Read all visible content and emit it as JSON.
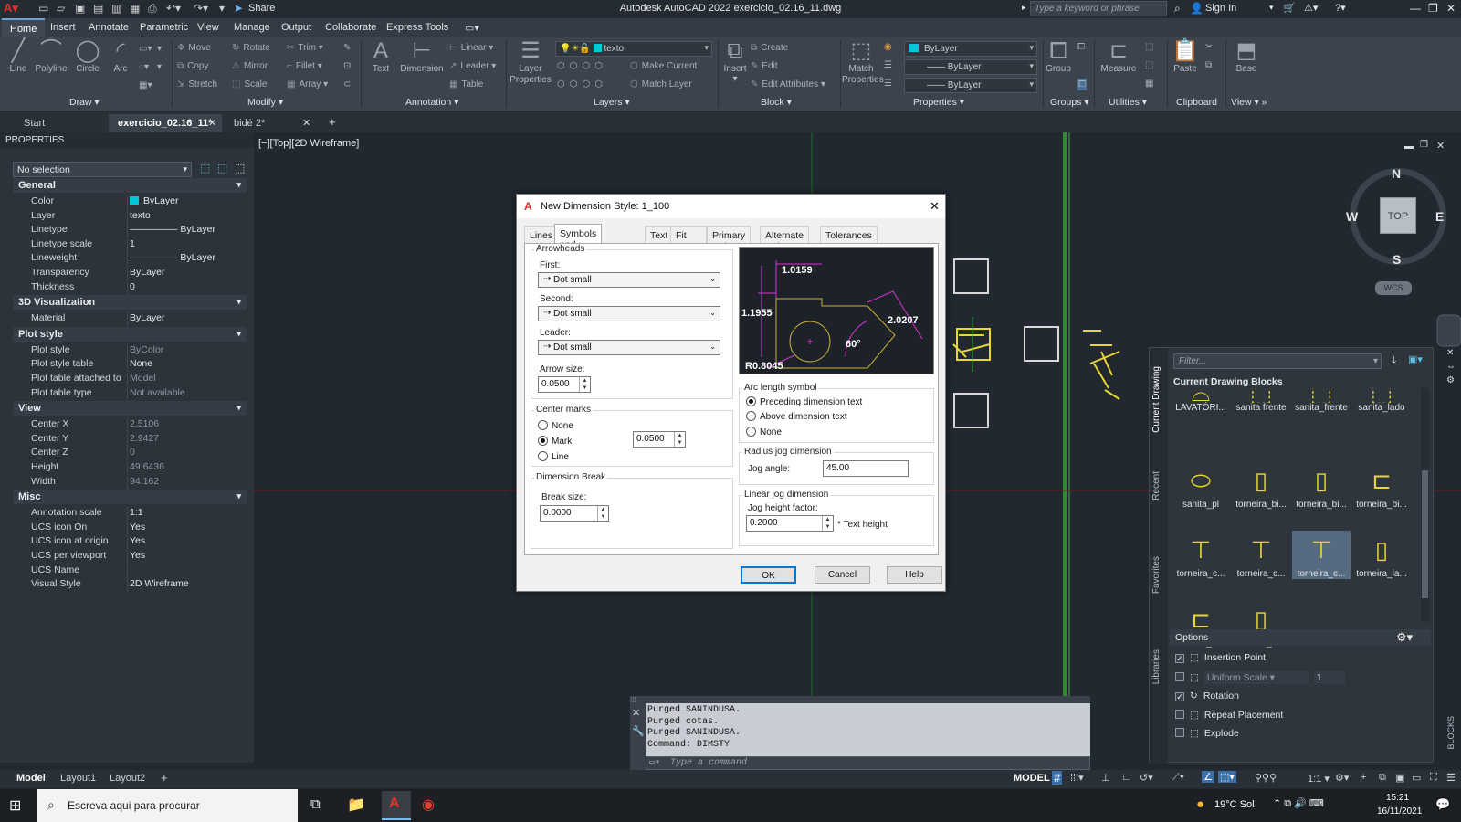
{
  "titlebar": {
    "title": "Autodesk AutoCAD 2022   exercicio_02.16_11.dwg",
    "share": "Share",
    "search_placeholder": "Type a keyword or phrase",
    "sign_in": "Sign In"
  },
  "ribbon_tabs": [
    "Home",
    "Insert",
    "Annotate",
    "Parametric",
    "View",
    "Manage",
    "Output",
    "Collaborate",
    "Express Tools"
  ],
  "draw": {
    "title": "Draw",
    "items": [
      "Line",
      "Polyline",
      "Circle",
      "Arc"
    ]
  },
  "modify": {
    "title": "Modify",
    "rows": [
      [
        "Move",
        "Rotate",
        "Trim"
      ],
      [
        "Copy",
        "Mirror",
        "Fillet"
      ],
      [
        "Stretch",
        "Scale",
        "Array"
      ]
    ]
  },
  "annotation": {
    "title": "Annotation",
    "text": "Text",
    "dimension": "Dimension",
    "linear": "Linear",
    "leader": "Leader",
    "table": "Table"
  },
  "layers": {
    "title": "Layers",
    "layer_properties": "Layer Properties",
    "current": "texto",
    "make_current": "Make Current",
    "match_layer": "Match Layer"
  },
  "block": {
    "title": "Block",
    "insert": "Insert",
    "create": "Create",
    "edit": "Edit",
    "edit_attributes": "Edit Attributes"
  },
  "properties_panel": {
    "title": "Properties",
    "match": "Match Properties",
    "color": "ByLayer",
    "linetype": "ByLayer",
    "lineweight": "ByLayer"
  },
  "groups": {
    "title": "Groups",
    "group": "Group"
  },
  "utilities": {
    "title": "Utilities",
    "measure": "Measure"
  },
  "clipboard": {
    "title": "Clipboard",
    "paste": "Paste"
  },
  "viewpanel": {
    "title": "View",
    "base": "Base"
  },
  "doc_tabs": [
    "Start",
    "exercicio_02.16_11*",
    "bidé 2*"
  ],
  "palette": {
    "header": "PROPERTIES",
    "selection": "No selection",
    "categories": [
      {
        "name": "General",
        "rows": [
          [
            "Color",
            "ByLayer"
          ],
          [
            "Layer",
            "texto"
          ],
          [
            "Linetype",
            "ByLayer"
          ],
          [
            "Linetype scale",
            "1"
          ],
          [
            "Lineweight",
            "ByLayer"
          ],
          [
            "Transparency",
            "ByLayer"
          ],
          [
            "Thickness",
            "0"
          ]
        ]
      },
      {
        "name": "3D Visualization",
        "rows": [
          [
            "Material",
            "ByLayer"
          ]
        ]
      },
      {
        "name": "Plot style",
        "rows": [
          [
            "Plot style",
            "ByColor"
          ],
          [
            "Plot style table",
            "None"
          ],
          [
            "Plot table attached to",
            "Model"
          ],
          [
            "Plot table type",
            "Not available"
          ]
        ]
      },
      {
        "name": "View",
        "rows": [
          [
            "Center X",
            "2.5106"
          ],
          [
            "Center Y",
            "2.9427"
          ],
          [
            "Center Z",
            "0"
          ],
          [
            "Height",
            "49.6436"
          ],
          [
            "Width",
            "94.162"
          ]
        ]
      },
      {
        "name": "Misc",
        "rows": [
          [
            "Annotation scale",
            "1:1"
          ],
          [
            "UCS icon On",
            "Yes"
          ],
          [
            "UCS icon at origin",
            "Yes"
          ],
          [
            "UCS per viewport",
            "Yes"
          ],
          [
            "UCS Name",
            ""
          ],
          [
            "Visual Style",
            "2D Wireframe"
          ]
        ]
      }
    ]
  },
  "viewport_label": "[−][Top][2D Wireframe]",
  "viewcube": {
    "n": "N",
    "s": "S",
    "e": "E",
    "w": "W",
    "top": "TOP",
    "wcs": "WCS"
  },
  "dialog": {
    "title": "New Dimension Style: 1_100",
    "tabs": [
      "Lines",
      "Symbols and Arrows",
      "Text",
      "Fit",
      "Primary Units",
      "Alternate Units",
      "Tolerances"
    ],
    "arrowheads": {
      "label": "Arrowheads",
      "first_label": "First:",
      "first": "Dot small",
      "second_label": "Second:",
      "second": "Dot small",
      "leader_label": "Leader:",
      "leader": "Dot small",
      "size_label": "Arrow size:",
      "size": "0.0500"
    },
    "center_marks": {
      "label": "Center marks",
      "none": "None",
      "mark": "Mark",
      "line": "Line",
      "value": "0.0500"
    },
    "dim_break": {
      "label": "Dimension Break",
      "size_label": "Break size:",
      "size": "0.0000"
    },
    "preview": {
      "a": "1.0159",
      "b": "1.1955",
      "c": "2.0207",
      "d": "60°",
      "e": "R0.8045"
    },
    "arc_length": {
      "label": "Arc length symbol",
      "preceding": "Preceding dimension text",
      "above": "Above dimension text",
      "none": "None"
    },
    "radius_jog": {
      "label": "Radius jog dimension",
      "angle_label": "Jog angle:",
      "angle": "45.00"
    },
    "linear_jog": {
      "label": "Linear jog dimension",
      "factor_label": "Jog height factor:",
      "factor": "0.2000",
      "suffix": "* Text height"
    },
    "ok": "OK",
    "cancel": "Cancel",
    "help": "Help"
  },
  "blocks": {
    "filter": "Filter...",
    "heading": "Current Drawing Blocks",
    "side_tabs": [
      "Current Drawing",
      "Recent",
      "Favorites",
      "Libraries"
    ],
    "items": [
      "LAVATÓRI...",
      "sanita frente",
      "sanita_frente",
      "sanita_lado",
      "sanita_pl",
      "torneira_bi...",
      "torneira_bi...",
      "torneira_bi...",
      "torneira_c...",
      "torneira_c...",
      "torneira_c...",
      "torneira_la...",
      "torneira_la...",
      "torneira_la..."
    ],
    "options": "Options",
    "insertion_point": "Insertion Point",
    "uniform_scale": "Uniform Scale",
    "scale_value": "1",
    "rotation": "Rotation",
    "repeat": "Repeat Placement",
    "explode": "Explode",
    "palette_label": "BLOCKS"
  },
  "command": {
    "history": [
      "Purged SANINDUSA.",
      "Purged cotas.",
      "Purged SANINDUSA.",
      "Command: DIMSTY"
    ],
    "placeholder": "Type a command"
  },
  "layout_tabs": [
    "Model",
    "Layout1",
    "Layout2"
  ],
  "status": {
    "model": "MODEL",
    "scale": "1:1"
  },
  "taskbar": {
    "search": "Escreva aqui para procurar",
    "weather": "19°C  Sol",
    "time": "15:21",
    "date": "16/11/2021"
  }
}
